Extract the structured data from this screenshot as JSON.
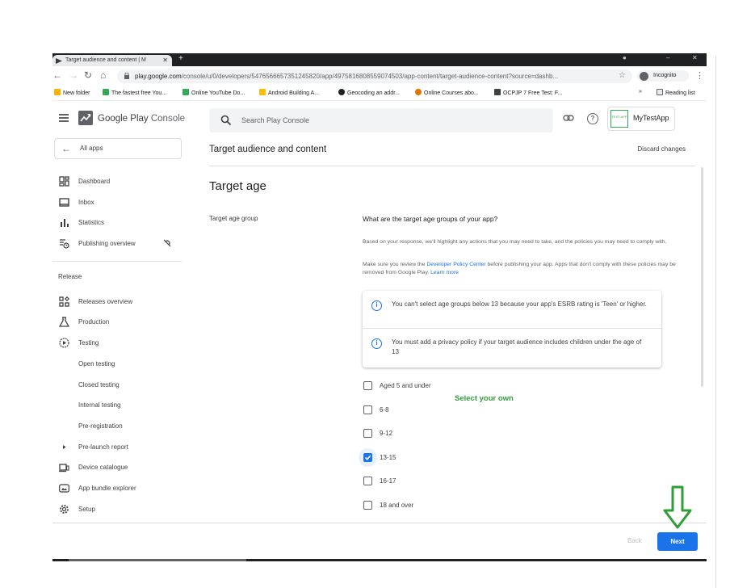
{
  "browser": {
    "tab_title": "Target audience and content | M",
    "url_domain": "play.google.com",
    "url_path": "/console/u/0/developers/5476566657351245820/app/4975816808559074503/app-content/target-audience-content?source=dashb...",
    "incognito_label": "Incognito",
    "bookmarks": [
      {
        "label": "New folder",
        "color": "#f4b400"
      },
      {
        "label": "The fastest free You...",
        "color": "#34a853"
      },
      {
        "label": "Online YouTube Do...",
        "color": "#34a853"
      },
      {
        "label": "Android Building A...",
        "color": "#fbbc04"
      },
      {
        "label": "Geocoding an addr...",
        "color": "#202124"
      },
      {
        "label": "Online Courses abo...",
        "color": "#e37400"
      },
      {
        "label": "OCPJP 7 Free Test: F...",
        "color": "#3c4043"
      }
    ],
    "overflow_label": "»",
    "reading_list_label": "Reading list"
  },
  "console": {
    "brand_primary": "Google Play",
    "brand_secondary": "Console",
    "search_placeholder": "Search Play Console",
    "app_name": "MyTestApp",
    "app_icon_text": "TEST APP"
  },
  "sidebar": {
    "all_apps": "All apps",
    "items": [
      {
        "label": "Dashboard",
        "icon": "dashboard-icon"
      },
      {
        "label": "Inbox",
        "icon": "inbox-icon"
      },
      {
        "label": "Statistics",
        "icon": "statistics-icon"
      },
      {
        "label": "Publishing overview",
        "icon": "publishing-overview-icon"
      }
    ],
    "release_heading": "Release",
    "release_items": [
      {
        "label": "Releases overview",
        "icon": "releases-overview-icon"
      },
      {
        "label": "Production",
        "icon": "production-icon"
      },
      {
        "label": "Testing",
        "icon": "testing-icon"
      },
      {
        "label": "Open testing",
        "icon": ""
      },
      {
        "label": "Closed testing",
        "icon": ""
      },
      {
        "label": "Internal testing",
        "icon": ""
      },
      {
        "label": "Pre-registration",
        "icon": ""
      },
      {
        "label": "Pre-launch report",
        "icon": "expand-arrow-icon"
      },
      {
        "label": "Device catalogue",
        "icon": "device-catalogue-icon"
      },
      {
        "label": "App bundle explorer",
        "icon": "app-bundle-explorer-icon"
      },
      {
        "label": "Setup",
        "icon": "setup-gear-icon"
      }
    ]
  },
  "main": {
    "page_title": "Target audience and content",
    "discard_label": "Discard changes",
    "section_title": "Target age",
    "field_label": "Target age group",
    "question": "What are the target age groups of your app?",
    "desc1": "Based on your response, we'll highlight any actions that you may need to take, and the policies you may need to comply with.",
    "desc2_pre": "Make sure you review the ",
    "desc2_link": "Developer Policy Center",
    "desc2_mid": " before publishing your app. Apps that don't comply with these policies may be removed from Google Play. ",
    "desc2_learn": "Learn more",
    "info1": "You can't select age groups below 13 because your app's ESRB rating is 'Teen' or higher.",
    "info2": "You must add a privacy policy if your target audience includes children under the age of 13",
    "age_groups": [
      {
        "label": "Aged 5 and under",
        "checked": false
      },
      {
        "label": "6-8",
        "checked": false
      },
      {
        "label": "9-12",
        "checked": false
      },
      {
        "label": "13-15",
        "checked": true
      },
      {
        "label": "16-17",
        "checked": false
      },
      {
        "label": "18 and over",
        "checked": false
      }
    ],
    "annotation": "Select your own"
  },
  "footer": {
    "back_label": "Back",
    "next_label": "Next"
  },
  "colors": {
    "accent": "#1a73e8",
    "annotation_green": "#2f9e3a"
  }
}
